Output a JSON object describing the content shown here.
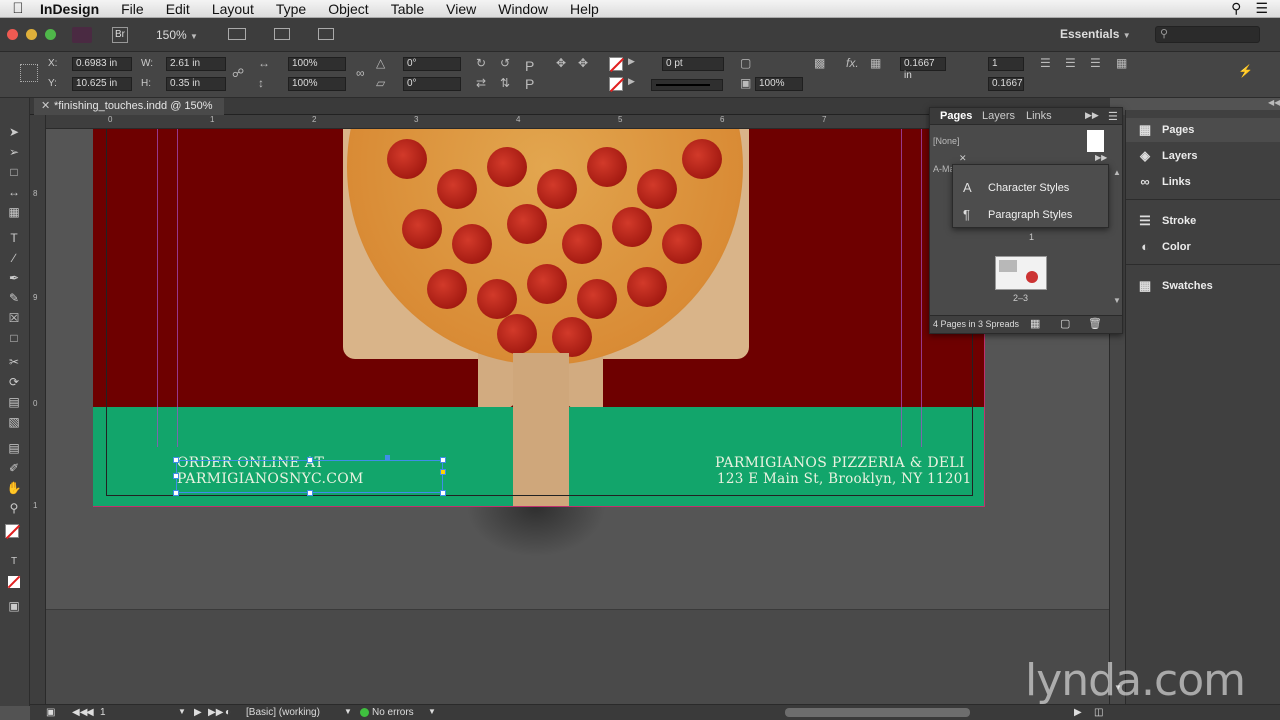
{
  "menubar": {
    "app": "InDesign",
    "items": [
      "File",
      "Edit",
      "Layout",
      "Type",
      "Object",
      "Table",
      "View",
      "Window",
      "Help"
    ]
  },
  "appbar": {
    "bridge_badge": "Br",
    "zoom": "150%",
    "workspace": "Essentials",
    "search_placeholder": ""
  },
  "control": {
    "x_label": "X:",
    "x_value": "0.6983 in",
    "y_label": "Y:",
    "y_value": "10.625 in",
    "w_label": "W:",
    "w_value": "2.61 in",
    "h_label": "H:",
    "h_value": "0.35 in",
    "scale_x": "100%",
    "scale_y": "100%",
    "rotate": "0°",
    "shear": "0°",
    "stroke_weight": "0 pt",
    "opacity": "100%",
    "offset": "0.1667 in",
    "columns": "1",
    "gutter": "0.1667"
  },
  "document": {
    "tab_title": "*finishing_touches.indd @ 150%",
    "ruler_h": [
      "0",
      "1",
      "2",
      "3",
      "4",
      "5",
      "6",
      "7"
    ],
    "ruler_v": [
      "8",
      "9",
      "0",
      "1"
    ],
    "left_text": [
      "ORDER ONLINE AT",
      "PARMIGIANOSNYC.COM"
    ],
    "right_text": [
      "PARMIGIANOS PIZZERIA & DELI",
      "123 E Main St, Brooklyn, NY 11201"
    ]
  },
  "pages_panel": {
    "tabs": [
      "Pages",
      "Layers",
      "Links"
    ],
    "none_label": "[None]",
    "master_label": "A-Ma",
    "page_number_top": "1",
    "spread_label": "2–3",
    "footer_text": "4 Pages in 3 Spreads"
  },
  "styles_popup": {
    "items": [
      "Character Styles",
      "Paragraph Styles"
    ]
  },
  "dock": {
    "items": [
      "Pages",
      "Layers",
      "Links",
      "Stroke",
      "Color",
      "Swatches"
    ]
  },
  "statusbar": {
    "page": "1",
    "profile": "[Basic] (working)",
    "errors": "No errors"
  },
  "watermark": "lynda.com",
  "colors": {
    "band_green": "#12a56b",
    "page_red": "#6e0000",
    "no_errors_dot": "#3fbf3f"
  }
}
